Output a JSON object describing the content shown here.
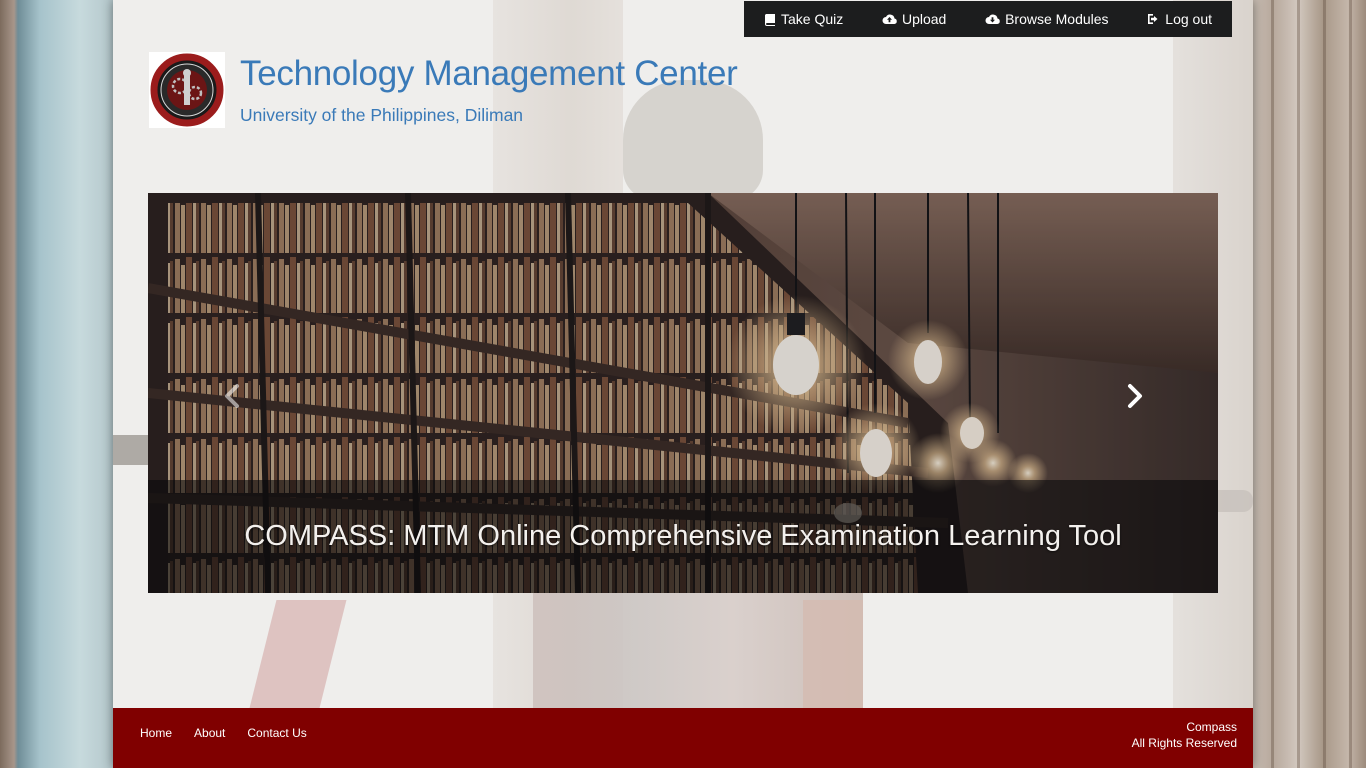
{
  "nav": {
    "items": [
      {
        "label": "Take Quiz",
        "icon": "book-icon"
      },
      {
        "label": "Upload",
        "icon": "cloud-upload-icon"
      },
      {
        "label": "Browse Modules",
        "icon": "cloud-download-icon"
      },
      {
        "label": "Log out",
        "icon": "sign-out-icon"
      }
    ]
  },
  "header": {
    "title": "Technology Management Center",
    "subtitle": "University of the Philippines, Diliman",
    "logo_icon": "tmc-seal-logo"
  },
  "carousel": {
    "caption": "COMPASS: MTM Online Comprehensive Examination Learning Tool",
    "prev_icon": "chevron-left-icon",
    "next_icon": "chevron-right-icon"
  },
  "footer": {
    "links": [
      "Home",
      "About",
      "Contact Us"
    ],
    "brand": "Compass",
    "rights": "All Rights Reserved"
  },
  "colors": {
    "accent": "#3a7ab8",
    "nav_bg": "#1c1d1e",
    "footer_bg": "#800000"
  }
}
